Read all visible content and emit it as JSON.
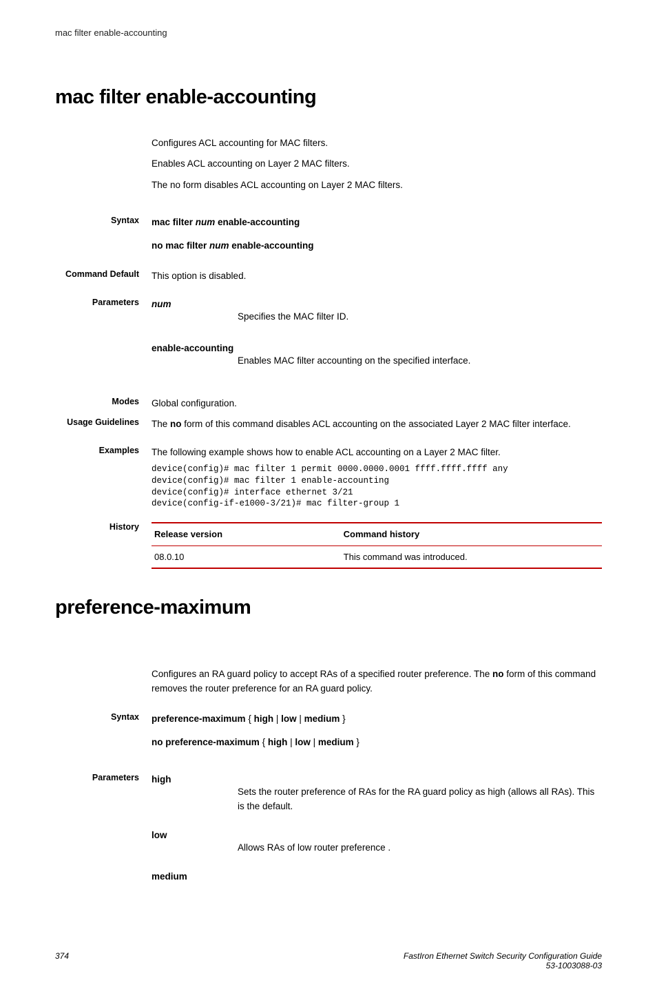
{
  "runningHeader": "mac filter enable-accounting",
  "section1": {
    "title": "mac filter enable-accounting",
    "intro1": "Configures ACL accounting for MAC filters.",
    "intro2": "Enables ACL accounting on Layer 2 MAC filters.",
    "intro3": "The no form disables ACL accounting on Layer 2 MAC filters.",
    "syntaxLabel": "Syntax",
    "syntax1_a": "mac filter ",
    "syntax1_b": "num",
    "syntax1_c": " enable-accounting",
    "syntax2_a": "no mac filter ",
    "syntax2_b": "num",
    "syntax2_c": " enable-accounting",
    "cmdDefaultLabel": "Command Default",
    "cmdDefaultValue": "This option is disabled.",
    "paramsLabel": "Parameters",
    "param1_name": "num",
    "param1_desc": "Specifies the MAC filter ID.",
    "param2_name": "enable-accounting",
    "param2_desc": "Enables MAC filter accounting on the specified interface.",
    "modesLabel": "Modes",
    "modesValue": "Global configuration.",
    "usageLabel": "Usage Guidelines",
    "usage_a": "The ",
    "usage_b": "no",
    "usage_c": " form of this command disables ACL accounting on the associated Layer 2 MAC filter interface.",
    "examplesLabel": "Examples",
    "examplesIntro": "The following example shows how to enable ACL accounting on a Layer 2 MAC filter.",
    "code": "device(config)# mac filter 1 permit 0000.0000.0001 ffff.ffff.ffff any\ndevice(config)# mac filter 1 enable-accounting\ndevice(config)# interface ethernet 3/21\ndevice(config-if-e1000-3/21)# mac filter-group 1",
    "historyLabel": "History",
    "historyH1": "Release version",
    "historyH2": "Command history",
    "historyR1C1": "08.0.10",
    "historyR1C2": "This command was introduced."
  },
  "section2": {
    "title": "preference-maximum",
    "intro_a": "Configures an RA guard policy to accept RAs of a specified router preference. The ",
    "intro_b": "no",
    "intro_c": " form of this command removes the router preference for an RA guard policy.",
    "syntaxLabel": "Syntax",
    "syntax1_a": "preference-maximum",
    "syntax1_b": " { ",
    "syntax1_c": "high",
    "syntax1_d": " | ",
    "syntax1_e": "low",
    "syntax1_f": " | ",
    "syntax1_g": "medium",
    "syntax1_h": " }",
    "syntax2_a": "no preference-maximum",
    "syntax2_b": " { ",
    "syntax2_c": "high",
    "syntax2_d": " | ",
    "syntax2_e": "low",
    "syntax2_f": " | ",
    "syntax2_g": "medium",
    "syntax2_h": " }",
    "paramsLabel": "Parameters",
    "param1_name": "high",
    "param1_desc": "Sets the router preference of RAs for the RA guard policy as high (allows all RAs). This is the default.",
    "param2_name": "low",
    "param2_desc": "Allows RAs of low router preference .",
    "param3_name": "medium"
  },
  "footer": {
    "pageNum": "374",
    "guide": "FastIron Ethernet Switch Security Configuration Guide",
    "docnum": "53-1003088-03"
  }
}
